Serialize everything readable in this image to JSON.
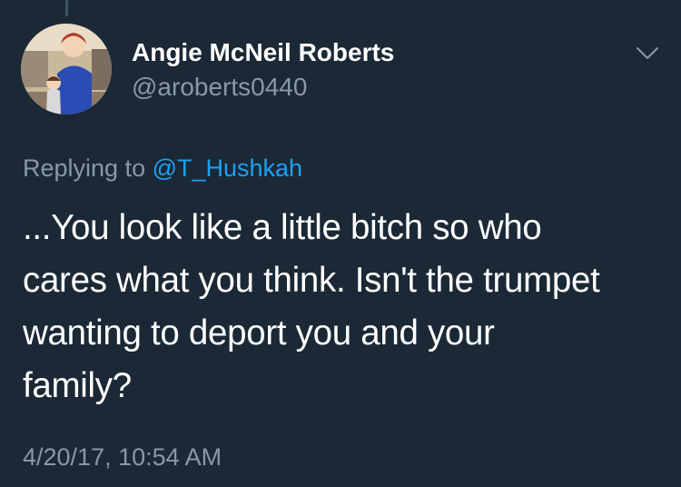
{
  "tweet": {
    "author_name": "Angie McNeil Roberts",
    "author_handle": "@aroberts0440",
    "avatar_icon": "profile-photo",
    "menu_icon": "chevron-down-icon",
    "replying_prefix": "Replying to ",
    "replying_to": "@T_Hushkah",
    "text_lines": [
      "...You look like a little bitch so who",
      "cares what you think. Isn't the trumpet",
      "wanting to deport you and your",
      "family?"
    ],
    "timestamp": "4/20/17, 10:54 AM"
  },
  "colors": {
    "background": "#1b2836",
    "secondary_text": "#8899a6",
    "link": "#1da1f2",
    "primary_text": "#ffffff"
  }
}
